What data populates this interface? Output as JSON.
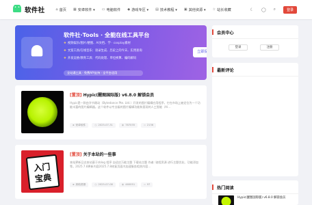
{
  "header": {
    "logo_text": "软件社",
    "nav": [
      {
        "icon": "home-icon",
        "glyph": "⌂",
        "label": "首页"
      },
      {
        "icon": "grid-icon",
        "glyph": "▦",
        "label": "安卓软件 ▾"
      },
      {
        "icon": "monitor-icon",
        "glyph": "▭",
        "label": "电脑软件"
      },
      {
        "icon": "gamepad-icon",
        "glyph": "◆",
        "label": "游戏专区 ▾"
      },
      {
        "icon": "book-icon",
        "glyph": "▤",
        "label": "技术教程 ▾"
      },
      {
        "icon": "box-icon",
        "glyph": "▣",
        "label": "其他资源 ▾"
      },
      {
        "icon": "star-icon",
        "glyph": "☆",
        "label": "站长收藏"
      }
    ],
    "login_label": "登录"
  },
  "hero": {
    "title": "软件社·Tools · 全能在线工具平台",
    "lines": [
      {
        "bullet": "❖",
        "text": "视频娱乐/图片/梗图、AI文档、学 · cosplay素材"
      },
      {
        "bullet": "❖",
        "text": "文案工具/在线音乐：语录生成、历史上的今天、实用查询"
      },
      {
        "bullet": "❖",
        "text": "开发运维/教育工具：代码处理、单位换算、编码解码"
      }
    ],
    "pill": "全站通工具 · 免费API支持 · 全平台适用",
    "button_label": "立即探索"
  },
  "posts": [
    {
      "tag": "[置顶]",
      "title": "Hypic(醒图国际版) v6.8.0 解锁会员",
      "excerpt": "Hypic是一款由字节跳动（Bytedance Pte. Ltd.）开发的图片编辑应用程序，它在市场上被定位为一个功能丰富的图片编辑器。这个软件以专业级的图片编辑功能和直观的人工智能（AI...",
      "meta": [
        {
          "icon": "user-icon",
          "text": "安卓软件"
        },
        {
          "icon": "clock-icon",
          "text": "2025-07-31"
        },
        {
          "icon": "eye-icon",
          "text": "787035"
        },
        {
          "icon": "comment-icon",
          "text": "2136"
        }
      ]
    },
    {
      "tag": "[置顶]",
      "title": "关于本站的一些事",
      "excerpt": "本站更新日志本站基于zblog 程序 自适应万能主题 下载站主题 作者: 驰程资源 进行主题优化、功能添加等。2025.7.8更新内容2025.7.8修复页面内加速服务相关内容...",
      "meta": [
        {
          "icon": "user-icon",
          "text": "其他资源"
        },
        {
          "icon": "clock-icon",
          "text": "2025-07-08"
        },
        {
          "icon": "eye-icon",
          "text": "460051"
        },
        {
          "icon": "comment-icon",
          "text": "97"
        }
      ],
      "thumb_text_1": "入门",
      "thumb_text_2": "宝典"
    }
  ],
  "sidebar": {
    "member_title": "会员中心",
    "member_login": "登录",
    "member_register": "注册",
    "comments_title": "最新评论",
    "hot_title": "热门阅读",
    "hot_items": [
      {
        "title": "Hypic(醒图国际版) v6.8.0 解锁会员"
      }
    ]
  },
  "colors": {
    "accent": "#e2483a",
    "hero_start": "#4a63e8",
    "hero_end": "#9f63e4",
    "android_green": "#3ddc84"
  }
}
